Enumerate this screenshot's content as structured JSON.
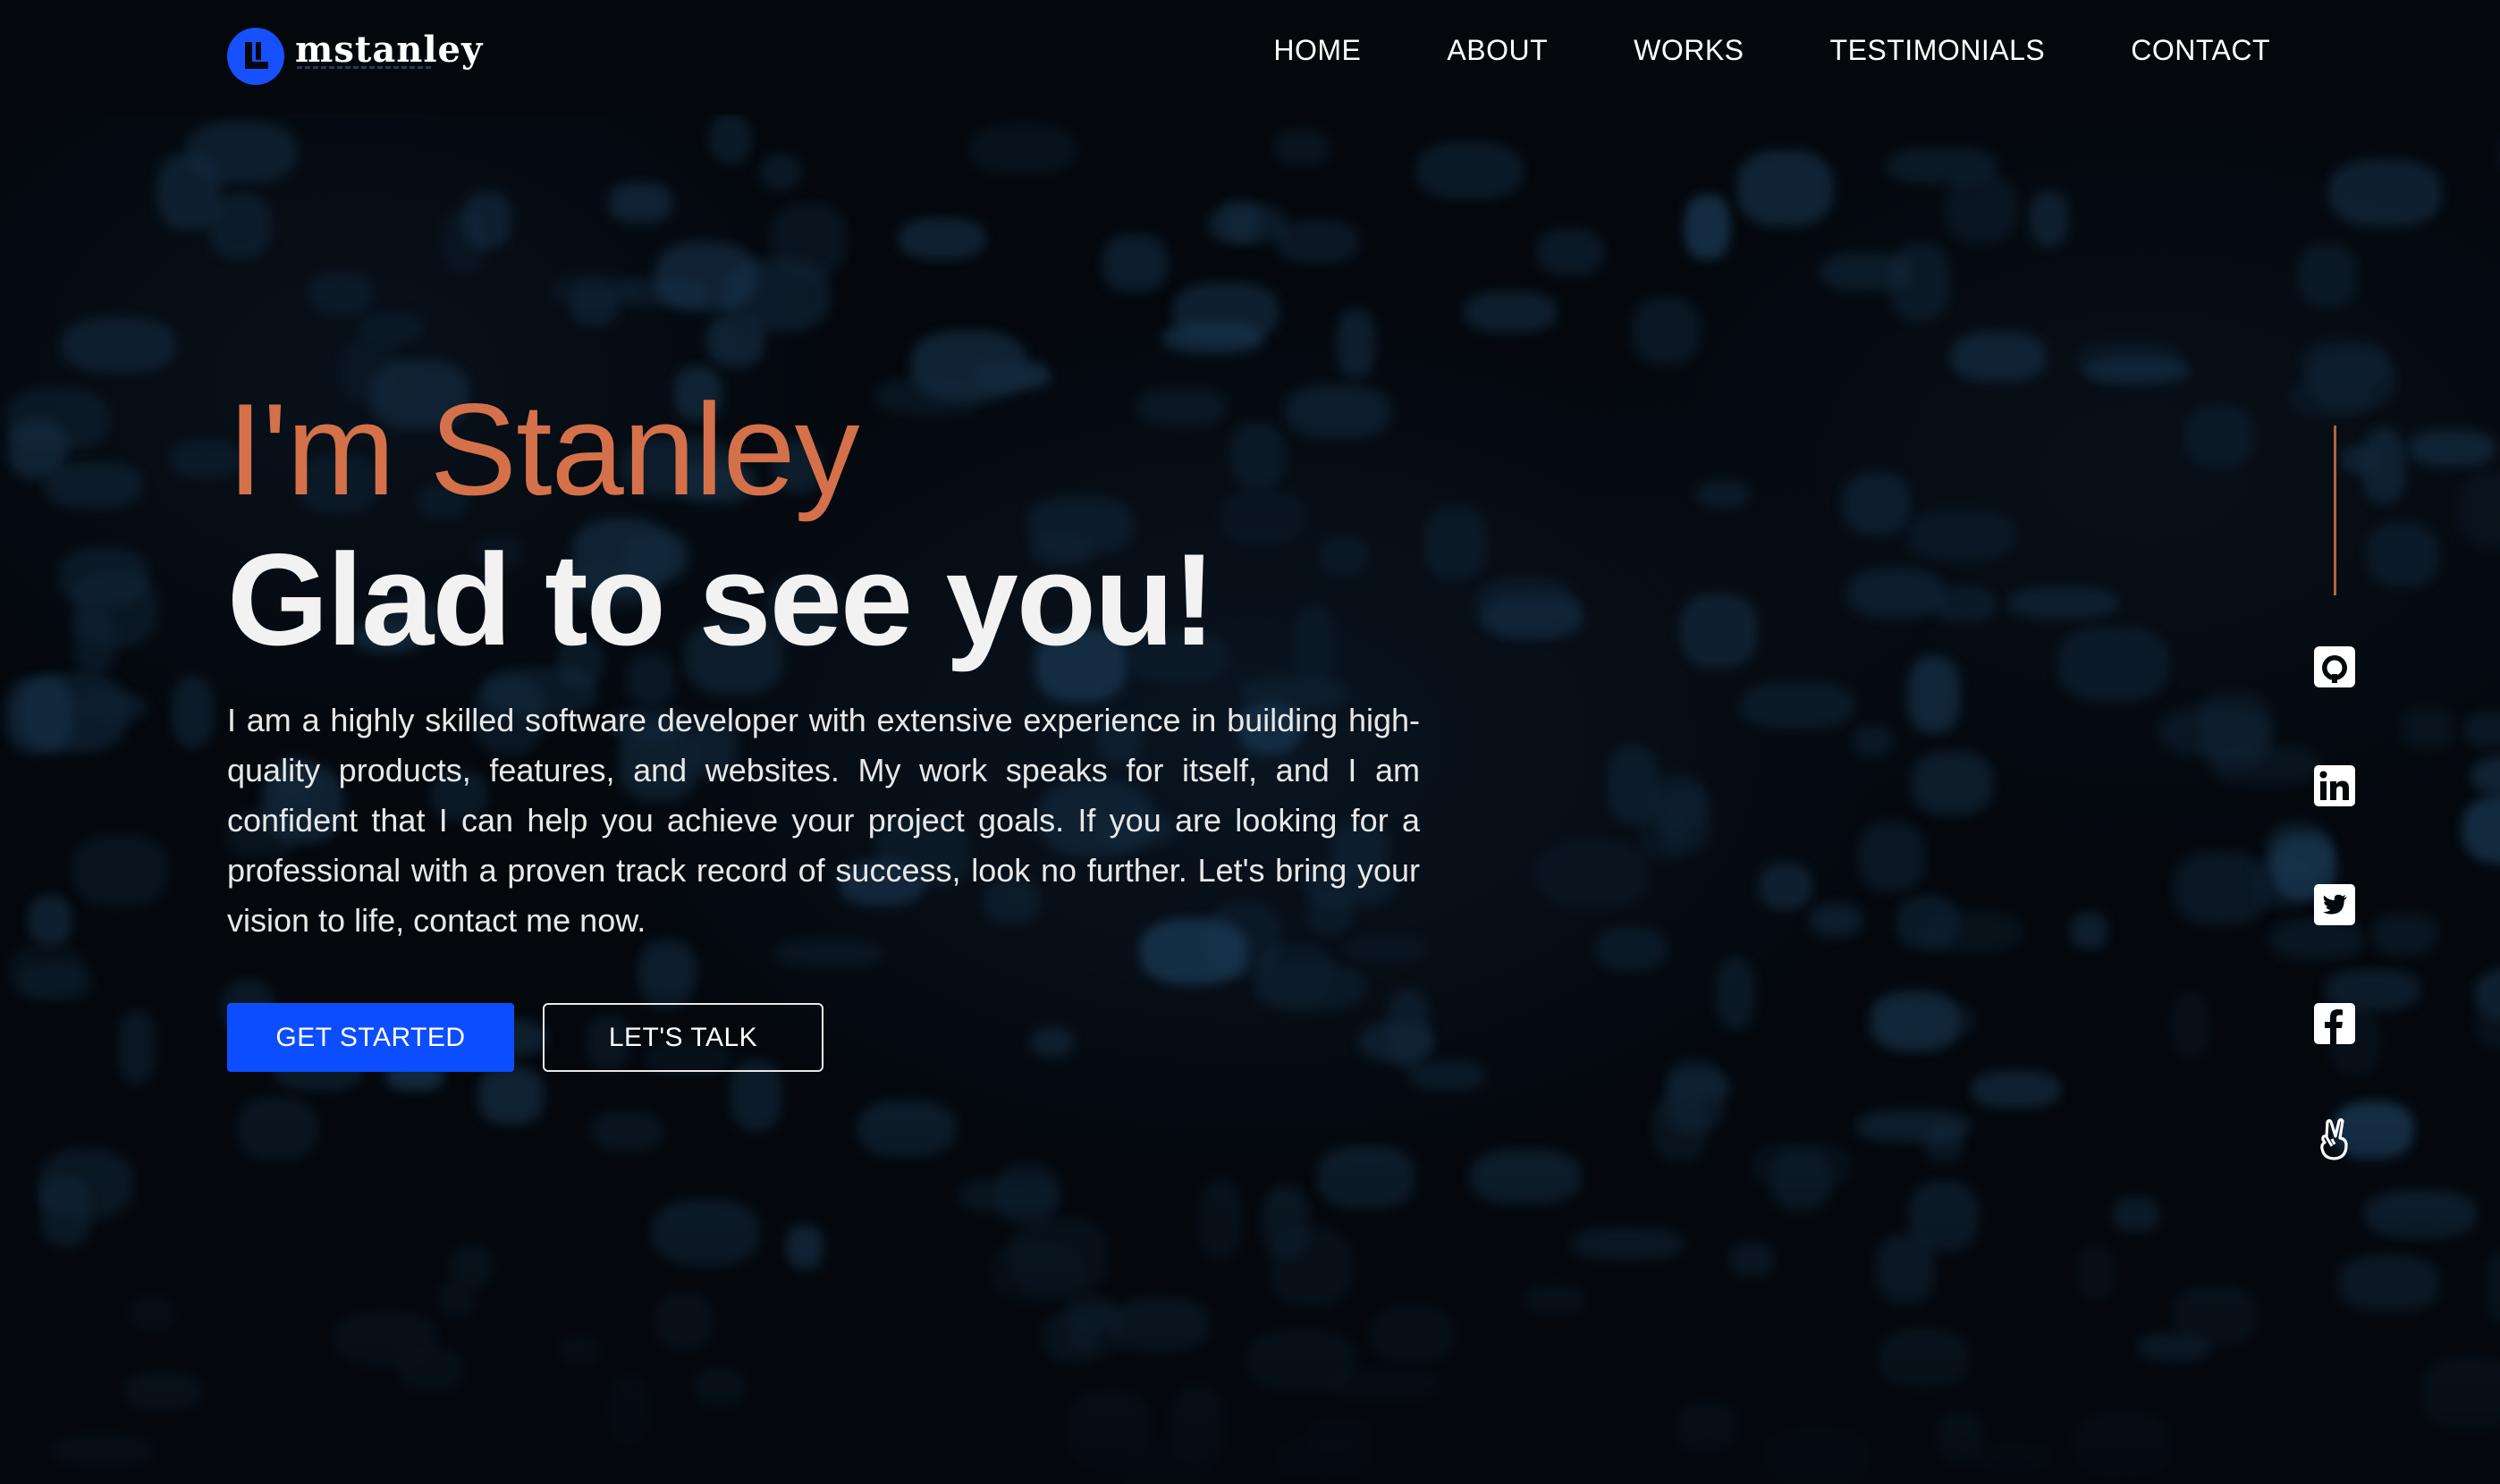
{
  "brand": {
    "name": "mstanley",
    "accent": "#1650ff"
  },
  "nav": {
    "items": [
      "HOME",
      "ABOUT",
      "WORKS",
      "TESTIMONIALS",
      "CONTACT"
    ]
  },
  "hero": {
    "intro": "I'm Stanley",
    "title": "Glad to see you!",
    "description": "I am a highly skilled software developer with extensive experience in building high-quality products, features, and websites. My work speaks for itself, and I am confident that I can help you achieve your project goals. If you are looking for a professional with a proven track record of success, look no further. Let's bring your vision to life, contact me now.",
    "intro_color": "#d4714a",
    "primary_button": "GET STARTED",
    "secondary_button": "LET'S TALK",
    "button_color": "#0c4dff"
  },
  "social": {
    "icons": [
      "github-icon",
      "linkedin-icon",
      "twitter-icon",
      "facebook-icon",
      "angellist-icon"
    ],
    "rail_color": "#b5613f"
  }
}
